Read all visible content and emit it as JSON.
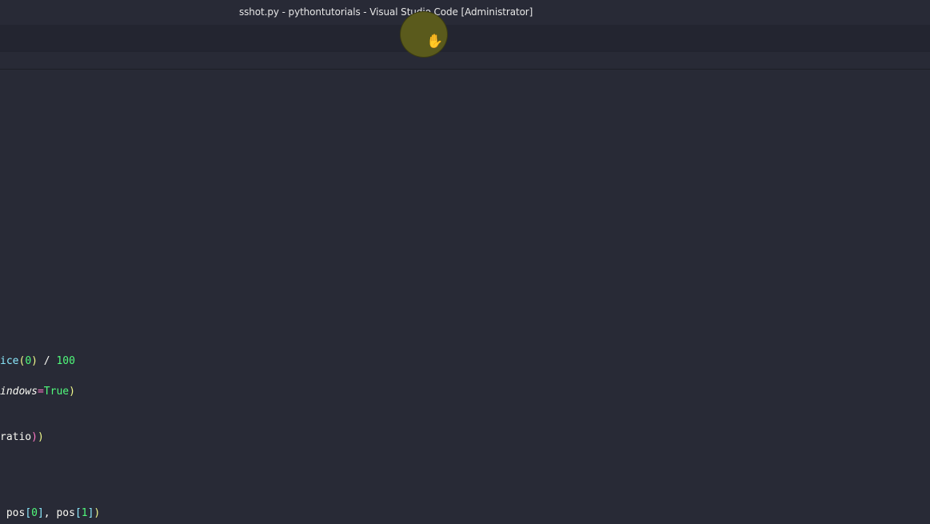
{
  "window": {
    "title": "sshot.py - pythontutorials - Visual Studio Code [Administrator]"
  },
  "editor": {
    "lines": [
      {
        "tokens": [
          {
            "text": "ice",
            "cls": "fn"
          },
          {
            "text": "(",
            "cls": "paren-y"
          },
          {
            "text": "0",
            "cls": "num"
          },
          {
            "text": ")",
            "cls": "paren-y"
          },
          {
            "text": " / ",
            "cls": ""
          },
          {
            "text": "100",
            "cls": "num"
          }
        ]
      },
      {
        "tokens": [
          {
            "text": "indows",
            "cls": "param"
          },
          {
            "text": "=",
            "cls": "op"
          },
          {
            "text": "True",
            "cls": "kw-const"
          },
          {
            "text": ")",
            "cls": "paren-y"
          }
        ]
      },
      {
        "tokens": [
          {
            "text": "ratio",
            "cls": ""
          },
          {
            "text": ")",
            "cls": "paren-p"
          },
          {
            "text": ")",
            "cls": "paren-y"
          }
        ]
      },
      {
        "tokens": [
          {
            "text": " pos",
            "cls": ""
          },
          {
            "text": "[",
            "cls": "br-c"
          },
          {
            "text": "0",
            "cls": "idx"
          },
          {
            "text": "]",
            "cls": "br-c"
          },
          {
            "text": ", pos",
            "cls": ""
          },
          {
            "text": "[",
            "cls": "br-c"
          },
          {
            "text": "1",
            "cls": "idx"
          },
          {
            "text": "]",
            "cls": "br-c"
          },
          {
            "text": ")",
            "cls": "paren-y"
          }
        ]
      }
    ]
  },
  "cursor": {
    "icon": "hand-cursor-icon",
    "glyph": "✋",
    "highlight_color": "#5a5a1c"
  }
}
